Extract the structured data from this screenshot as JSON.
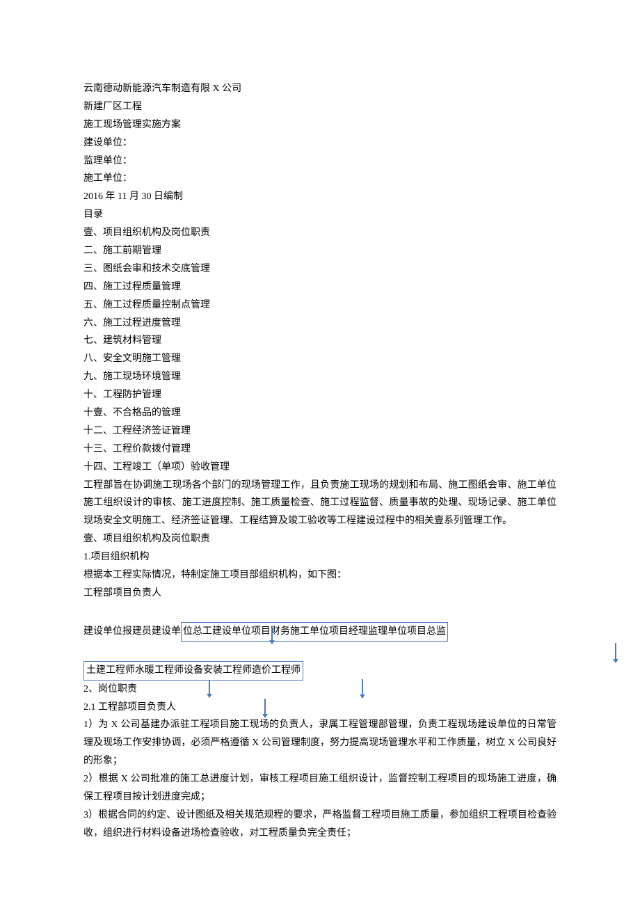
{
  "header": {
    "company": "云南德动新能源汽车制造有限 X 公司",
    "project": "新建厂区工程",
    "doctype": "施工现场管理实施方案",
    "builder_label": "建设单位：",
    "supervisor_label": "监理单位：",
    "constructor_label": "施工单位：",
    "date": "2016 年 11 月 30 日编制"
  },
  "toc": {
    "heading": "目录",
    "items": [
      "壹、项目组织机构及岗位职责",
      "二、施工前期管理",
      "三、图纸会审和技术交底管理",
      "四、施工过程质量管理",
      "五、施工过程质量控制点管理",
      "六、施工过程进度管理",
      "七、建筑材料管理",
      "八、安全文明施工管理",
      "九、施工现场环境管理",
      "十、工程防护管理",
      "十壹、不合格品的管理",
      "十二、工程经济签证管理",
      "十三、工程价款拨付管理",
      "十四、工程竣工（单项）验收管理"
    ]
  },
  "intro": "工程部旨在协调施工现场各个部门的现场管理工作，且负责施工现场的规划和布局、施工图纸会审、施工单位施工组织设计的审核、施工进度控制、施工质量检查、施工过程监督、质量事故的处理、现场记录、施工单位现场安全文明施工、经济签证管理、工程结算及竣工验收等工程建设过程中的相关壹系列管理工作。",
  "section1": {
    "title": "壹、项目组织机构及岗位职责",
    "sub1_num": "1.项目组织机构",
    "sub1_text": "根据本工程实际情况，特制定施工项目部组织机构，如下图：",
    "org_top": "工程部项目负责人",
    "org_row1_prefix": "建设单位报建员建设单",
    "org_row1_box": "位总工建设单位项目财务施工单位项目经理监理单位项目总监",
    "org_row2_box": "土建工程师水暖工程师设备安装工程师造价工程师",
    "sub2_title": "2、岗位职责",
    "sub2_1_title": "2.1 工程部项目负责人",
    "items": [
      "1）为 X 公司基建办派驻工程项目施工现场的负责人，隶属工程管理部管理，负责工程现场建设单位的日常管理及现场工作安排协调，必须严格遵循 X 公司管理制度，努力提高现场管理水平和工作质量，树立 X 公司良好的形象；",
      "2）根据 X 公司批准的施工总进度计划，审核工程项目施工组织设计，监督控制工程项目的现场施工进度，确保工程项目按计划进度完成；",
      "3）根据合同的约定、设计图纸及相关规范规程的要求，严格监督工程项目施工质量，参加组织工程项目检查验收，组织进行材料设备进场检查验收，对工程质量负完全责任；"
    ]
  }
}
